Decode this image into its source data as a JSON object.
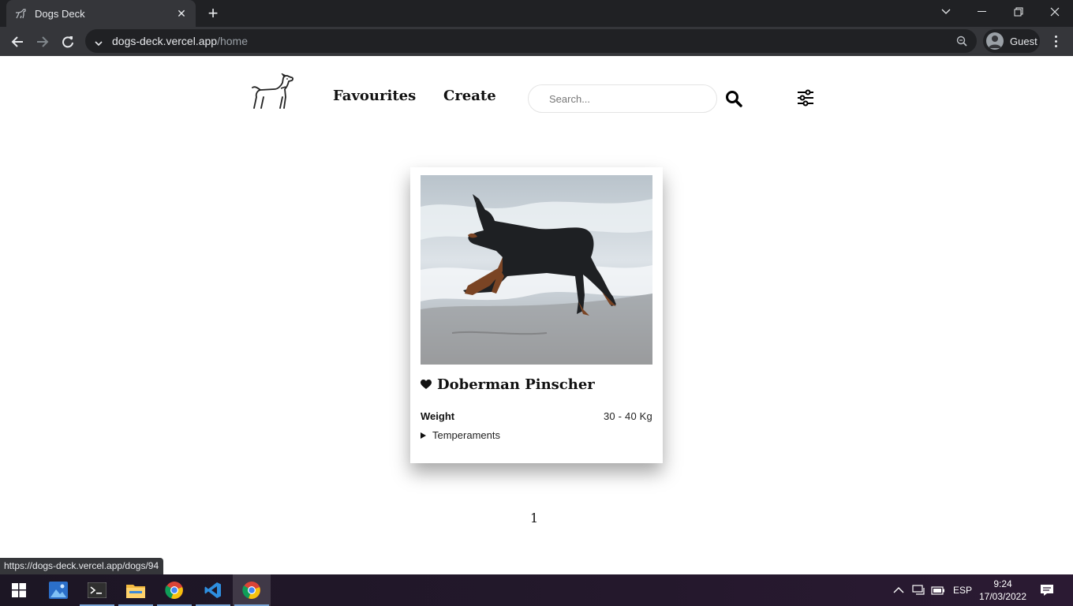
{
  "browser": {
    "tab_title": "Dogs Deck",
    "url_host": "dogs-deck.vercel.app",
    "url_path": "/home",
    "profile_label": "Guest",
    "status_url": "https://dogs-deck.vercel.app/dogs/94"
  },
  "header": {
    "nav_links": [
      "Favourites",
      "Create"
    ],
    "search_placeholder": "Search..."
  },
  "cards": [
    {
      "name": "Doberman Pinscher",
      "weight_label": "Weight",
      "weight_value": "30 - 40 Kg",
      "temperaments_label": "Temperaments"
    }
  ],
  "pagination": {
    "current": "1"
  },
  "taskbar": {
    "language": "ESP",
    "time": "9:24",
    "date": "17/03/2022"
  },
  "colors": {
    "chrome_dark": "#202124",
    "chrome_toolbar": "#35363a",
    "text_primary": "#111111"
  }
}
